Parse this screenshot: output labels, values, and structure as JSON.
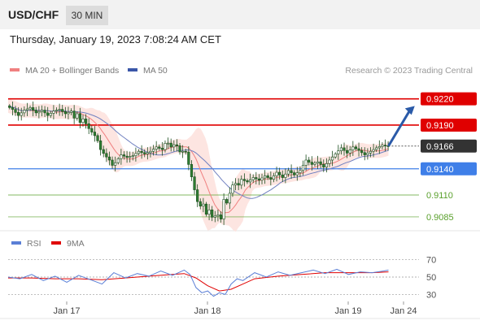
{
  "header": {
    "symbol": "USD/CHF",
    "interval": "30 MIN"
  },
  "timestamp": "Thursday, January 19, 2023 7:08:24 AM CET",
  "legend": [
    {
      "label": "MA 20 + Bollinger Bands",
      "color": "#f08080"
    },
    {
      "label": "MA 50",
      "color": "#3a56a8"
    }
  ],
  "credit": "Research © 2023 Trading Central",
  "rsi_legend": [
    {
      "label": "RSI",
      "color": "#5b7fd6"
    },
    {
      "label": "9MA",
      "color": "#e00000"
    }
  ],
  "colors": {
    "resistance": "#e00000",
    "support_blue": "#3f7fe8",
    "support_green": "#5aa02c",
    "current": "#333333",
    "candle": "#2e7d32",
    "bollinger_fill": "#fde0dc",
    "arrow": "#2a5aa8"
  },
  "chart_data": {
    "type": "candlestick",
    "instrument": "USD/CHF",
    "interval": "30 MIN",
    "y_range": [
      0.9071,
      0.9242
    ],
    "x_ticks": [
      "Jan 17",
      "Jan 18",
      "Jan 19",
      "Jan 24"
    ],
    "levels": [
      {
        "value": 0.922,
        "label": "0.9220",
        "kind": "resistance"
      },
      {
        "value": 0.919,
        "label": "0.9190",
        "kind": "resistance"
      },
      {
        "value": 0.9166,
        "label": "0.9166",
        "kind": "current"
      },
      {
        "value": 0.914,
        "label": "0.9140",
        "kind": "support"
      },
      {
        "value": 0.911,
        "label": "0.9110",
        "kind": "support"
      },
      {
        "value": 0.9085,
        "label": "0.9085",
        "kind": "support"
      }
    ],
    "price_path": [
      [
        0,
        0.9212
      ],
      [
        10,
        0.9208
      ],
      [
        20,
        0.9201
      ],
      [
        30,
        0.9207
      ],
      [
        40,
        0.921
      ],
      [
        50,
        0.9204
      ],
      [
        60,
        0.9207
      ],
      [
        70,
        0.9201
      ],
      [
        80,
        0.9206
      ],
      [
        90,
        0.9208
      ],
      [
        100,
        0.9203
      ],
      [
        110,
        0.9206
      ],
      [
        115,
        0.9198
      ],
      [
        120,
        0.9203
      ],
      [
        125,
        0.9193
      ],
      [
        130,
        0.9197
      ],
      [
        140,
        0.9186
      ],
      [
        150,
        0.9178
      ],
      [
        155,
        0.9172
      ],
      [
        160,
        0.9162
      ],
      [
        168,
        0.9155
      ],
      [
        175,
        0.915
      ],
      [
        180,
        0.9144
      ],
      [
        185,
        0.9147
      ],
      [
        195,
        0.9156
      ],
      [
        205,
        0.9153
      ],
      [
        215,
        0.9155
      ],
      [
        225,
        0.916
      ],
      [
        235,
        0.9157
      ],
      [
        245,
        0.916
      ],
      [
        255,
        0.9165
      ],
      [
        265,
        0.9162
      ],
      [
        272,
        0.9172
      ],
      [
        280,
        0.9165
      ],
      [
        288,
        0.9169
      ],
      [
        296,
        0.9158
      ],
      [
        304,
        0.9162
      ],
      [
        310,
        0.9145
      ],
      [
        316,
        0.9128
      ],
      [
        322,
        0.911
      ],
      [
        328,
        0.9095
      ],
      [
        334,
        0.9102
      ],
      [
        340,
        0.9088
      ],
      [
        346,
        0.9094
      ],
      [
        352,
        0.908
      ],
      [
        358,
        0.9092
      ],
      [
        364,
        0.9078
      ],
      [
        370,
        0.9105
      ],
      [
        376,
        0.91
      ],
      [
        382,
        0.9118
      ],
      [
        388,
        0.9125
      ],
      [
        394,
        0.912
      ],
      [
        400,
        0.9128
      ],
      [
        410,
        0.9125
      ],
      [
        420,
        0.913
      ],
      [
        430,
        0.9127
      ],
      [
        440,
        0.9132
      ],
      [
        450,
        0.9128
      ],
      [
        460,
        0.9136
      ],
      [
        470,
        0.913
      ],
      [
        480,
        0.9138
      ],
      [
        490,
        0.9133
      ],
      [
        500,
        0.9138
      ],
      [
        510,
        0.915
      ],
      [
        520,
        0.9145
      ],
      [
        530,
        0.9148
      ],
      [
        540,
        0.9142
      ],
      [
        550,
        0.915
      ],
      [
        560,
        0.9157
      ],
      [
        570,
        0.9164
      ],
      [
        580,
        0.9158
      ],
      [
        590,
        0.9165
      ],
      [
        600,
        0.9161
      ],
      [
        610,
        0.9156
      ],
      [
        620,
        0.916
      ],
      [
        630,
        0.9164
      ],
      [
        640,
        0.9167
      ],
      [
        648,
        0.9166
      ]
    ],
    "forecast_arrow": [
      [
        648,
        0.9166
      ],
      [
        690,
        0.921
      ]
    ],
    "rsi": {
      "levels": [
        70,
        50,
        30
      ],
      "y_range": [
        22,
        78
      ],
      "rsi_series": [
        [
          0,
          50
        ],
        [
          20,
          48
        ],
        [
          40,
          53
        ],
        [
          60,
          46
        ],
        [
          80,
          51
        ],
        [
          100,
          44
        ],
        [
          120,
          52
        ],
        [
          140,
          47
        ],
        [
          160,
          42
        ],
        [
          180,
          55
        ],
        [
          200,
          49
        ],
        [
          220,
          54
        ],
        [
          240,
          51
        ],
        [
          260,
          57
        ],
        [
          280,
          52
        ],
        [
          300,
          58
        ],
        [
          310,
          53
        ],
        [
          320,
          38
        ],
        [
          330,
          32
        ],
        [
          340,
          34
        ],
        [
          350,
          28
        ],
        [
          360,
          32
        ],
        [
          370,
          30
        ],
        [
          380,
          42
        ],
        [
          390,
          48
        ],
        [
          400,
          46
        ],
        [
          420,
          55
        ],
        [
          440,
          50
        ],
        [
          460,
          56
        ],
        [
          480,
          52
        ],
        [
          500,
          55
        ],
        [
          520,
          58
        ],
        [
          540,
          54
        ],
        [
          560,
          59
        ],
        [
          580,
          53
        ],
        [
          600,
          56
        ],
        [
          620,
          55
        ],
        [
          640,
          57
        ],
        [
          648,
          58
        ]
      ],
      "ma9_series": [
        [
          0,
          49
        ],
        [
          40,
          49
        ],
        [
          80,
          48
        ],
        [
          120,
          48
        ],
        [
          160,
          47
        ],
        [
          200,
          49
        ],
        [
          240,
          51
        ],
        [
          280,
          53
        ],
        [
          300,
          54
        ],
        [
          320,
          49
        ],
        [
          340,
          40
        ],
        [
          360,
          34
        ],
        [
          380,
          36
        ],
        [
          400,
          42
        ],
        [
          420,
          48
        ],
        [
          460,
          51
        ],
        [
          500,
          53
        ],
        [
          540,
          55
        ],
        [
          580,
          55
        ],
        [
          620,
          55
        ],
        [
          648,
          56
        ]
      ]
    }
  }
}
